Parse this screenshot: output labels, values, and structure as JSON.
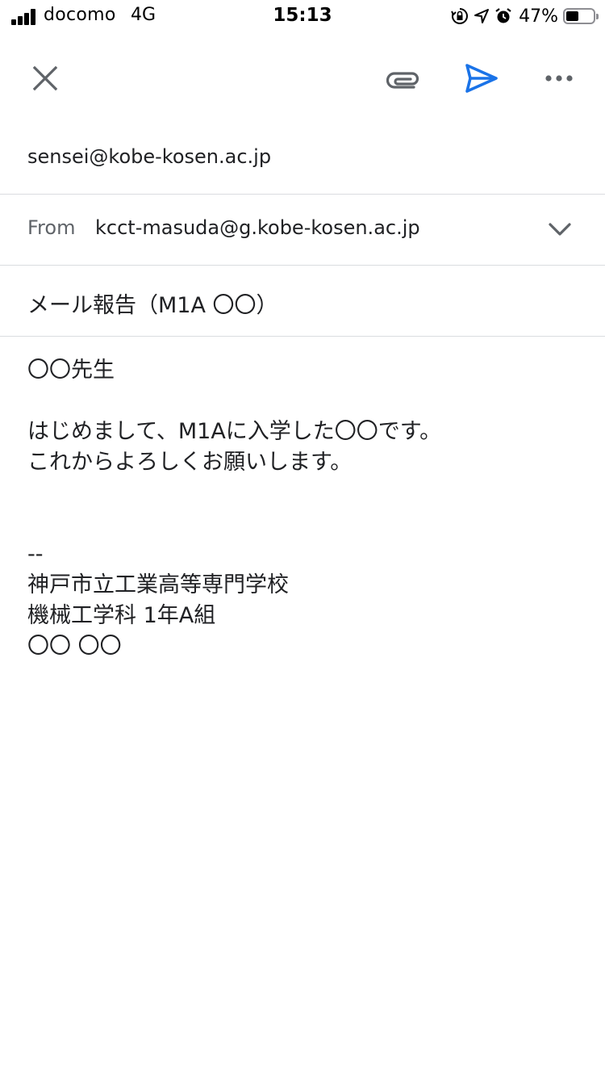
{
  "status_bar": {
    "carrier": "docomo",
    "network": "4G",
    "time": "15:13",
    "battery_percent": "47%",
    "battery_level": 0.47,
    "icons": [
      "signal-icon",
      "orientation-lock-icon",
      "location-icon",
      "alarm-icon",
      "battery-icon"
    ]
  },
  "toolbar": {
    "icons": [
      "close-icon",
      "paperclip-icon",
      "send-icon",
      "more-icon"
    ],
    "send_color": "#1a73e8",
    "icon_color": "#5f6368"
  },
  "compose": {
    "to": "sensei@kobe-kosen.ac.jp",
    "from_label": "From",
    "from_value": "kcct-masuda@g.kobe-kosen.ac.jp",
    "subject": "メール報告（M1A 〇〇）",
    "body": {
      "greeting": "〇〇先生",
      "line1": "はじめまして、M1Aに入学した〇〇です。",
      "line2": "これからよろしくお願いします。",
      "sig_separator": "--",
      "sig_school": "神戸市立工業高等専門学校",
      "sig_department": "機械工学科 1年A組",
      "sig_name": "〇〇 〇〇"
    }
  }
}
